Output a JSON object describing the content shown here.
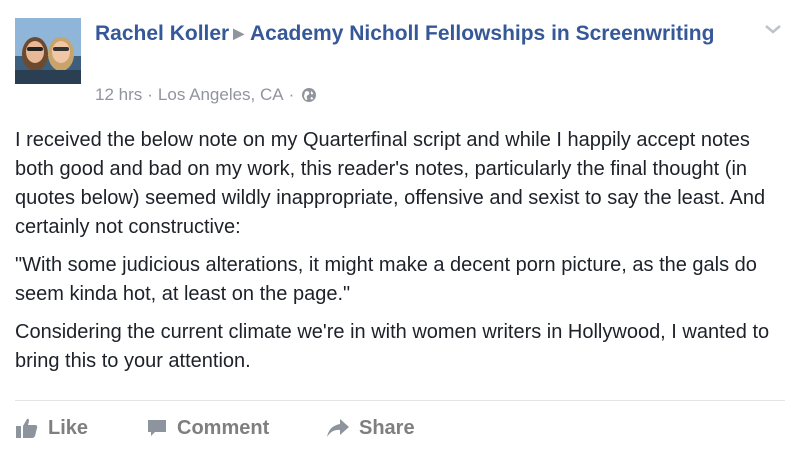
{
  "post": {
    "author": "Rachel Koller",
    "target_page": "Academy Nicholl Fellowships in Screenwriting",
    "time": "12 hrs",
    "location": "Los Angeles, CA",
    "separator": "·",
    "audience_icon": "globe-icon",
    "paragraphs": [
      "I received the below note on my Quarterfinal script and while I happily accept notes both good and bad on my work, this reader's notes, particularly the final thought (in quotes below) seemed wildly inappropriate, offensive and sexist to say the least. And certainly not constructive:",
      "\"With some judicious alterations, it might make a decent porn picture, as the gals do seem kinda hot, at least on the page.\"",
      "Considering the current climate we're in with women writers in Hollywood, I wanted to bring this to your attention."
    ]
  },
  "actions": {
    "like": "Like",
    "comment": "Comment",
    "share": "Share"
  },
  "colors": {
    "link": "#365899",
    "meta": "#90949c",
    "text": "#1d2129",
    "action": "#7f7f7f"
  }
}
